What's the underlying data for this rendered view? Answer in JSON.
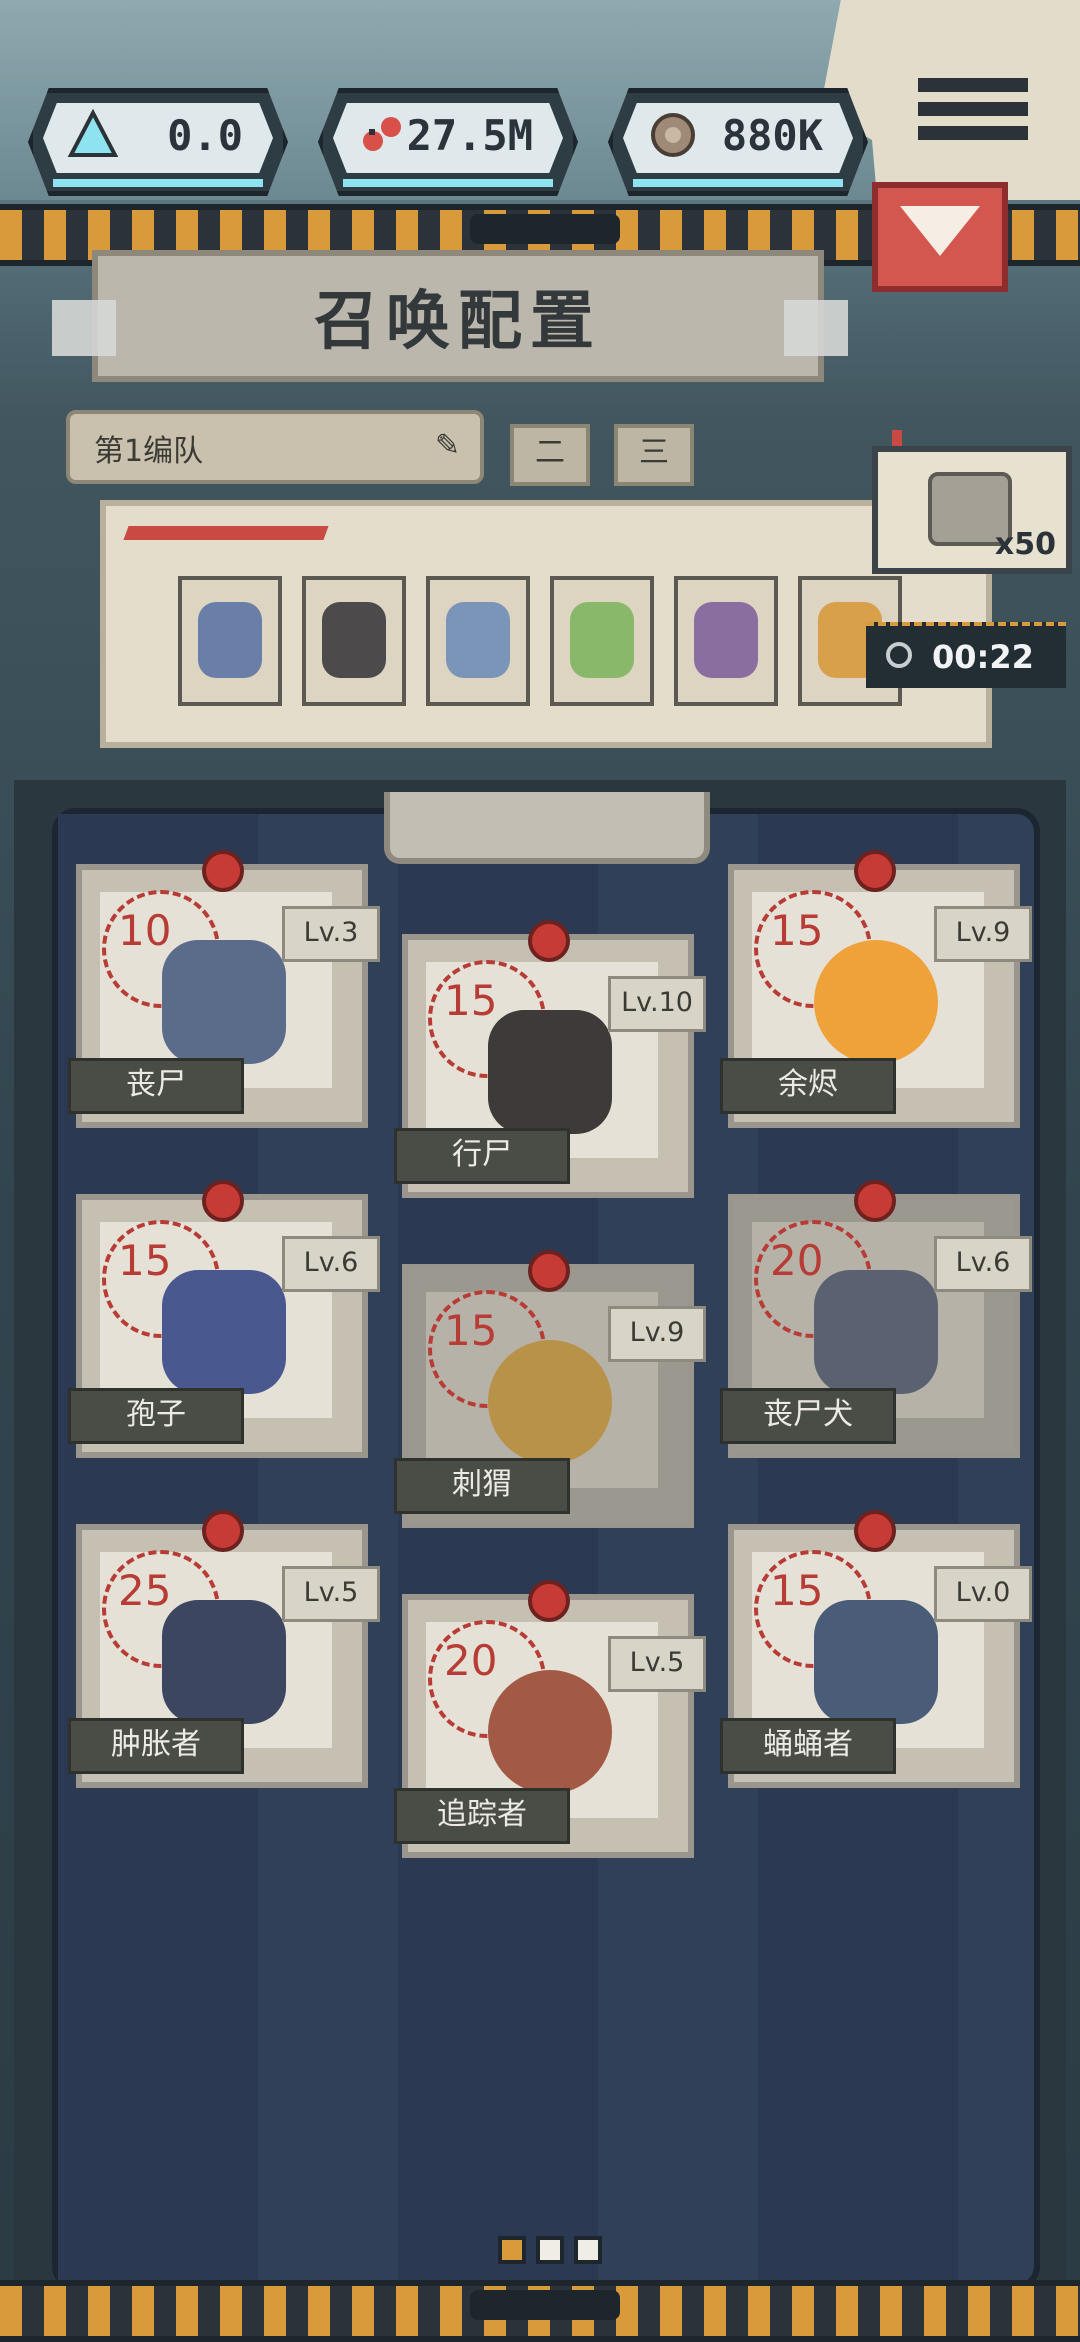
{
  "resources": [
    {
      "icon": "crystal-icon",
      "value": "0.0"
    },
    {
      "icon": "gene-icon",
      "value": "27.5M"
    },
    {
      "icon": "shell-icon",
      "value": "880K"
    }
  ],
  "title": "召唤配置",
  "team": {
    "name": "第1编队",
    "tabs": [
      "二",
      "三"
    ]
  },
  "crate": {
    "count": "x50"
  },
  "timer": "00:22",
  "loadout_slots": [
    "slot-1",
    "slot-2",
    "slot-3",
    "slot-4",
    "slot-5",
    "slot-6"
  ],
  "cards": [
    {
      "name": "丧尸",
      "cost": "10",
      "level": "Lv.3",
      "color": "#5b6b8a"
    },
    {
      "name": "行尸",
      "cost": "15",
      "level": "Lv.10",
      "color": "#3f3a3a"
    },
    {
      "name": "余烬",
      "cost": "15",
      "level": "Lv.9",
      "color": "#f0a23a"
    },
    {
      "name": "孢子",
      "cost": "15",
      "level": "Lv.6",
      "color": "#4a5890"
    },
    {
      "name": "刺猬",
      "cost": "15",
      "level": "Lv.9",
      "color": "#b89248"
    },
    {
      "name": "丧尸犬",
      "cost": "20",
      "level": "Lv.6",
      "color": "#5a6272"
    },
    {
      "name": "肿胀者",
      "cost": "25",
      "level": "Lv.5",
      "color": "#3c4660"
    },
    {
      "name": "追踪者",
      "cost": "20",
      "level": "Lv.5",
      "color": "#a35a44"
    },
    {
      "name": "蛹蛹者",
      "cost": "15",
      "level": "Lv.0",
      "color": "#4a5c78"
    }
  ],
  "colors": {
    "accent": "#d89a3a",
    "danger": "#d4574f",
    "panel": "#2f4058"
  }
}
